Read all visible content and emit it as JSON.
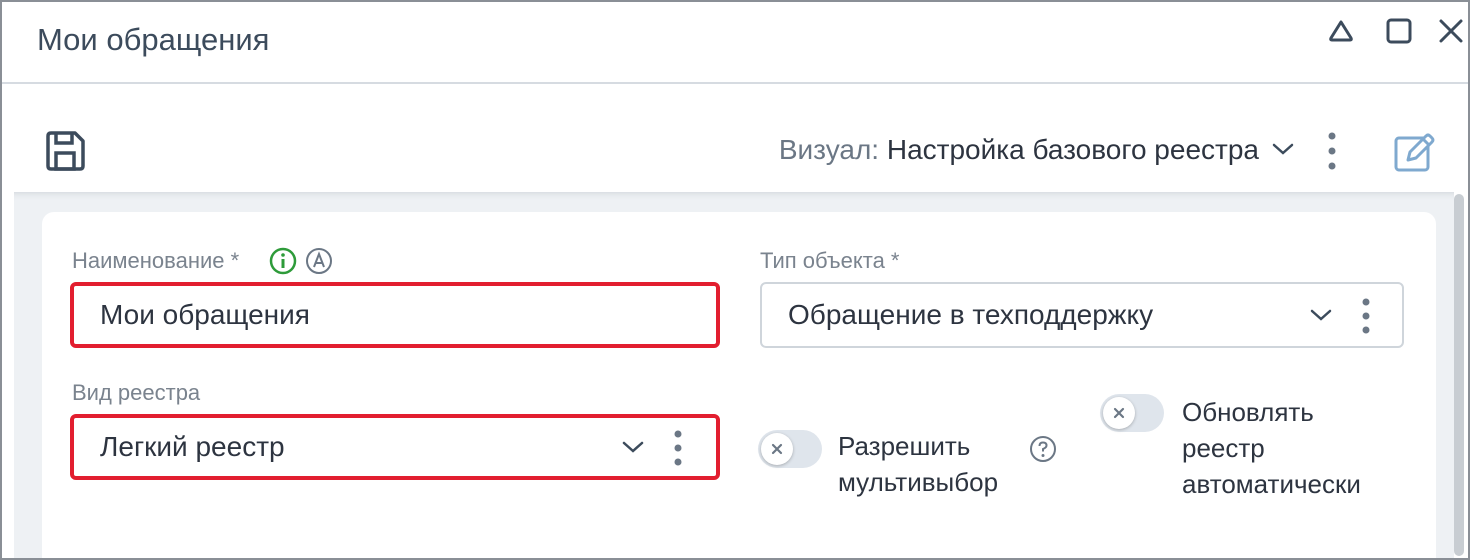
{
  "window": {
    "title": "Мои обращения"
  },
  "toolbar": {
    "visual_label": "Визуал:",
    "visual_value": "Настройка базового реестра"
  },
  "form": {
    "name_label": "Наименование *",
    "name_value": "Мои обращения",
    "object_type_label": "Тип объекта *",
    "object_type_value": "Обращение в техподдержку",
    "registry_type_label": "Вид реестра",
    "registry_type_value": "Легкий реестр",
    "multiselect_label_line1": "Разрешить",
    "multiselect_label_line2": "мультивыбор",
    "autorefresh_label_line1": "Обновлять",
    "autorefresh_label_line2": "реестр",
    "autorefresh_label_line3": "автоматически"
  },
  "colors": {
    "error_border": "#e21e2f",
    "info_icon": "#2e9b3a",
    "text": "#2d3440",
    "label": "#7a838e"
  },
  "icons": {
    "minimize": "triangle-collapse-icon",
    "maximize": "square-maximize-icon",
    "close": "close-icon",
    "save": "floppy-disk-icon",
    "edit": "edit-pencil-icon"
  }
}
